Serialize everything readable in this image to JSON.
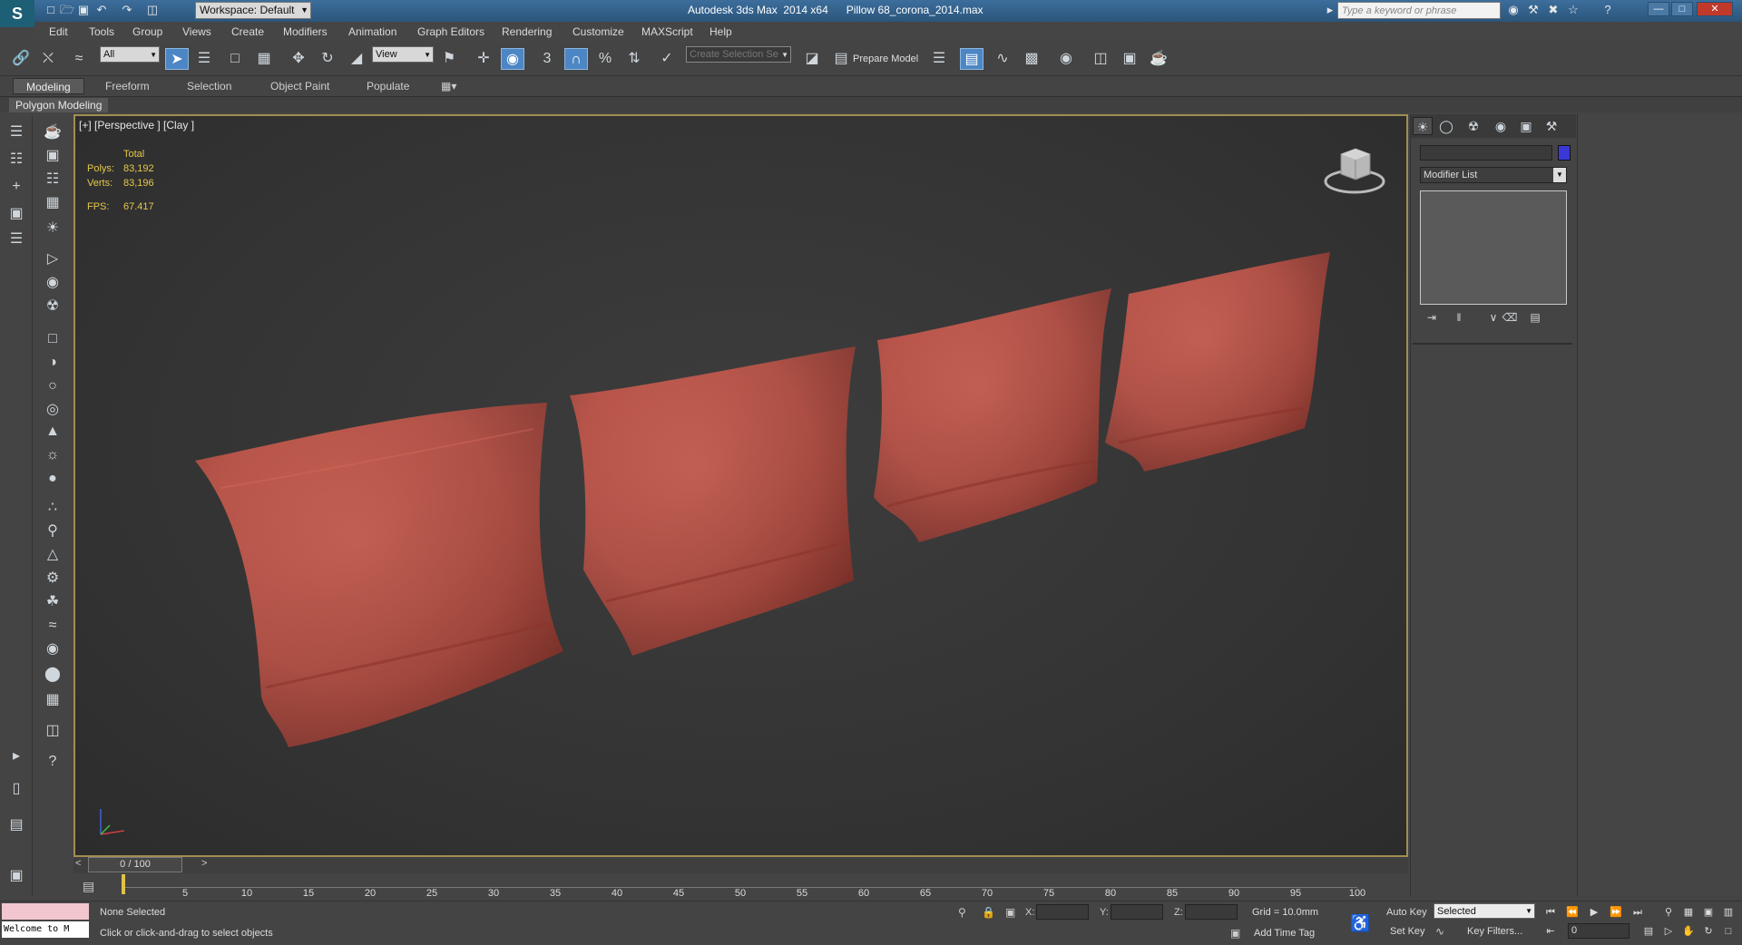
{
  "title_bar": {
    "workspace": "Workspace: Default",
    "app_title": "Autodesk 3ds Max  2014 x64",
    "file_name": "Pillow 68_corona_2014.max",
    "search_placeholder": "Type a keyword or phrase"
  },
  "menu": [
    "Edit",
    "Tools",
    "Group",
    "Views",
    "Create",
    "Modifiers",
    "Animation",
    "Graph Editors",
    "Rendering",
    "Customize",
    "MAXScript",
    "Help"
  ],
  "main_toolbar": {
    "selection_filter": "All",
    "reference_coord": "View",
    "snap_label": "3",
    "named_selection_placeholder": "Create Selection Se",
    "prepare_model_label": "Prepare Model"
  },
  "ribbon": {
    "tabs": [
      "Modeling",
      "Freeform",
      "Selection",
      "Object Paint",
      "Populate"
    ],
    "active_tab": "Modeling",
    "panel_label": "Polygon Modeling"
  },
  "viewport": {
    "label": "[+] [Perspective ] [Clay ]",
    "stats": {
      "header": "Total",
      "polys_label": "Polys:",
      "polys_value": "83,192",
      "verts_label": "Verts:",
      "verts_value": "83,196",
      "fps_label": "FPS:",
      "fps_value": "67.417"
    },
    "pillow_color": "#b7483a",
    "border_color": "#a08e52"
  },
  "command_panel": {
    "modifier_list_label": "Modifier List",
    "object_color": "#3b38d8"
  },
  "time_slider": {
    "frame_display": "0 / 100",
    "current_frame": 0,
    "total_frames": 100,
    "tick_labels": [
      "5",
      "10",
      "15",
      "20",
      "25",
      "30",
      "35",
      "40",
      "45",
      "50",
      "55",
      "60",
      "65",
      "70",
      "75",
      "80",
      "85",
      "90",
      "95",
      "100"
    ]
  },
  "status_bar": {
    "maxscript_text": "Welcome to M",
    "selection_status": "None Selected",
    "prompt": "Click or click-and-drag to select objects",
    "x_label": "X:",
    "y_label": "Y:",
    "z_label": "Z:",
    "grid": "Grid = 10.0mm",
    "add_time_tag": "Add Time Tag",
    "auto_key": "Auto Key",
    "set_key": "Set Key",
    "key_mode": "Selected",
    "key_filters": "Key Filters...",
    "current_frame_field": "0"
  }
}
